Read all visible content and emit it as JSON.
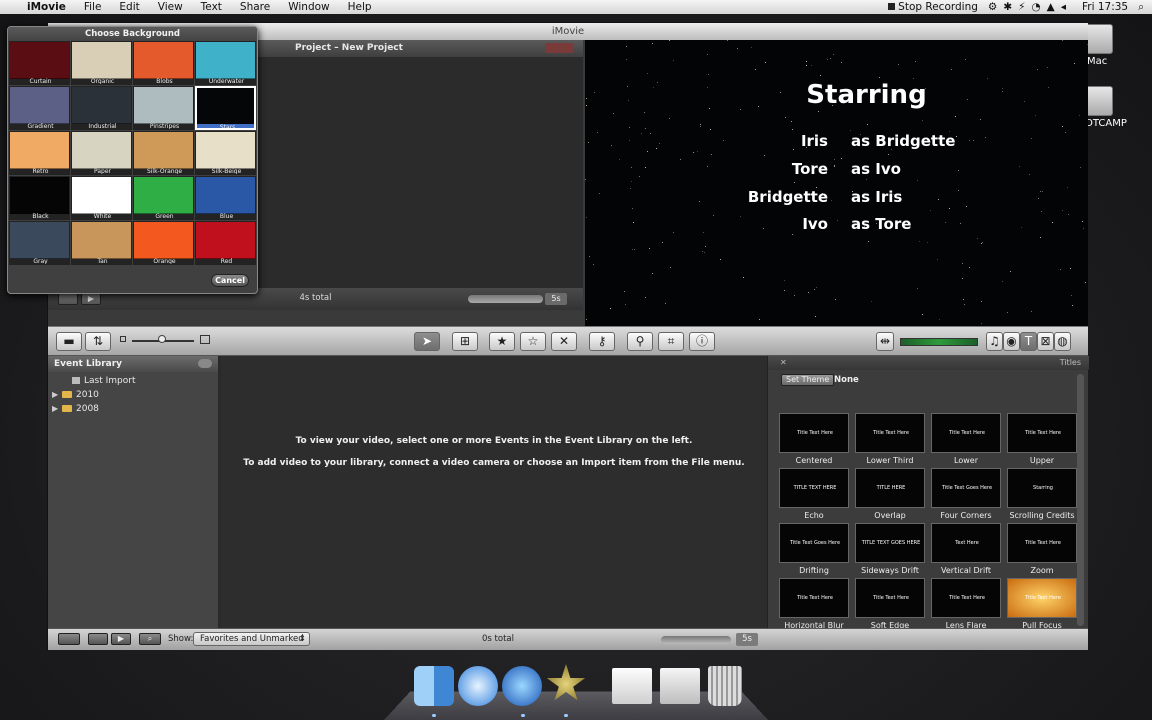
{
  "menubar": {
    "apple": "",
    "app": "iMovie",
    "items": [
      "File",
      "Edit",
      "View",
      "Text",
      "Share",
      "Window",
      "Help"
    ],
    "stop_recording": "Stop Recording",
    "clock": "Fri 17:35"
  },
  "desktop": {
    "icons": [
      {
        "label": "Mac",
        "icon": "hard-drive-icon"
      },
      {
        "label": "OTCAMP",
        "icon": "hard-drive-icon"
      }
    ]
  },
  "window": {
    "title": "iMovie",
    "project": {
      "title": "Project – New Project",
      "total": "4s total",
      "zoom": "5s"
    },
    "viewer": {
      "title": "Starring",
      "credits": [
        {
          "name": "Iris",
          "role": "as Bridgette"
        },
        {
          "name": "Tore",
          "role": "as Ivo"
        },
        {
          "name": "Bridgette",
          "role": "as Iris"
        },
        {
          "name": "Ivo",
          "role": "as Tore"
        }
      ]
    },
    "event_library": {
      "header": "Event Library",
      "items": [
        {
          "label": "Last Import",
          "expandable": false
        },
        {
          "label": "2010",
          "expandable": true
        },
        {
          "label": "2008",
          "expandable": true
        }
      ]
    },
    "event_browser": {
      "msg1": "To view your video, select one or more Events in the Event Library on the left.",
      "msg2": "To add video to your library, connect a video camera or choose an Import item from the File menu."
    },
    "titles_panel": {
      "header": "Titles",
      "set_theme_label": "Set Theme",
      "theme_value": "None",
      "tiles": [
        {
          "label": "Centered",
          "thumb": "Title Text Here"
        },
        {
          "label": "Lower Third",
          "thumb": "Title Text Here"
        },
        {
          "label": "Lower",
          "thumb": "Title Text Here"
        },
        {
          "label": "Upper",
          "thumb": "Title Text Here"
        },
        {
          "label": "Echo",
          "thumb": "TITLE TEXT HERE"
        },
        {
          "label": "Overlap",
          "thumb": "TITLE HERE"
        },
        {
          "label": "Four Corners",
          "thumb": "Title Text Goes Here"
        },
        {
          "label": "Scrolling Credits",
          "thumb": "Starring"
        },
        {
          "label": "Drifting",
          "thumb": "Title Text Goes Here"
        },
        {
          "label": "Sideways Drift",
          "thumb": "TITLE TEXT GOES HERE"
        },
        {
          "label": "Vertical Drift",
          "thumb": "Text Here"
        },
        {
          "label": "Zoom",
          "thumb": "Title Text Here"
        },
        {
          "label": "Horizontal Blur",
          "thumb": "Title Text Here"
        },
        {
          "label": "Soft Edge",
          "thumb": "Title Text Here"
        },
        {
          "label": "Lens Flare",
          "thumb": "Title Text Here"
        },
        {
          "label": "Pull Focus",
          "thumb": "Title Text Here"
        }
      ]
    },
    "bottombar": {
      "show_label": "Show:",
      "filter_value": "Favorites and Unmarked",
      "total": "0s total",
      "zoom": "5s"
    }
  },
  "background_panel": {
    "title": "Choose Background",
    "cancel_label": "Cancel",
    "selected": "Stars",
    "tiles": [
      {
        "label": "Curtain",
        "color": "#5a0d12"
      },
      {
        "label": "Organic",
        "color": "#d9cfb6"
      },
      {
        "label": "Blobs",
        "color": "#e55a2c"
      },
      {
        "label": "Underwater",
        "color": "#3fb2c9"
      },
      {
        "label": "Gradient",
        "color": "#5c5f86"
      },
      {
        "label": "Industrial",
        "color": "#2b3138"
      },
      {
        "label": "Pinstripes",
        "color": "#aebcbf"
      },
      {
        "label": "Stars",
        "color": "#050608"
      },
      {
        "label": "Retro",
        "color": "#f0aa64"
      },
      {
        "label": "Paper",
        "color": "#d7d5c2"
      },
      {
        "label": "Silk-Orange",
        "color": "#cf9a58"
      },
      {
        "label": "Silk-Beige",
        "color": "#e7dfc7"
      },
      {
        "label": "Black",
        "color": "#050505"
      },
      {
        "label": "White",
        "color": "#ffffff"
      },
      {
        "label": "Green",
        "color": "#2fae45"
      },
      {
        "label": "Blue",
        "color": "#2b58a6"
      },
      {
        "label": "Gray",
        "color": "#3a4a5c"
      },
      {
        "label": "Tan",
        "color": "#c8955a"
      },
      {
        "label": "Orange",
        "color": "#f3591e"
      },
      {
        "label": "Red",
        "color": "#c0101e"
      }
    ]
  },
  "dock": {
    "apps": [
      "finder-icon",
      "safari-icon",
      "quicktime-icon",
      "imovie-icon",
      "document-icon",
      "preview-icon",
      "trash-icon"
    ]
  }
}
